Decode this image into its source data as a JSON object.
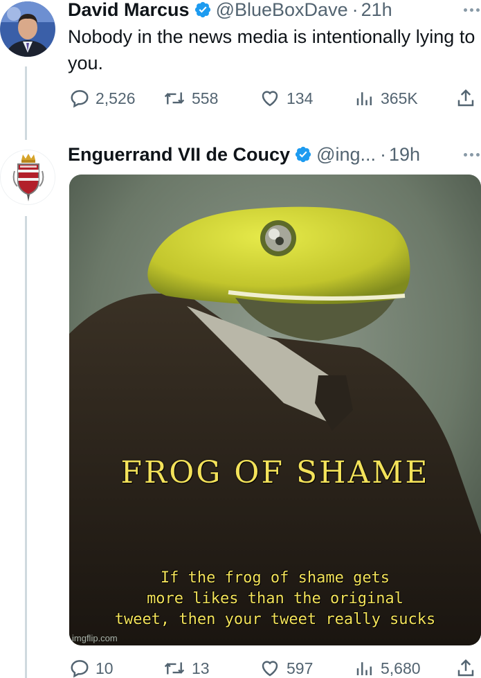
{
  "tweets": [
    {
      "display_name": "David Marcus",
      "handle": "@BlueBoxDave",
      "time": "21h",
      "text": "Nobody in the news media is intentionally lying to you.",
      "stats": {
        "replies": "2,526",
        "reposts": "558",
        "likes": "134",
        "views": "365K"
      }
    },
    {
      "display_name": "Enguerrand VII de Coucy",
      "handle": "@ing...",
      "time": "19h",
      "media": {
        "title": "FROG OF SHAME",
        "caption": "If the frog of shame gets\nmore likes than the original\ntweet, then your tweet really sucks",
        "watermark": "imgflip.com"
      },
      "stats": {
        "replies": "10",
        "reposts": "13",
        "likes": "597",
        "views": "5,680"
      }
    }
  ],
  "separator": "·",
  "colors": {
    "verified": "#1d9bf0",
    "muted": "#536471",
    "line": "#cfd9de",
    "meme_text": "#f3e25a"
  },
  "icons": [
    "verified-badge-icon",
    "more-icon",
    "reply-icon",
    "repost-icon",
    "like-icon",
    "views-icon",
    "share-icon"
  ]
}
